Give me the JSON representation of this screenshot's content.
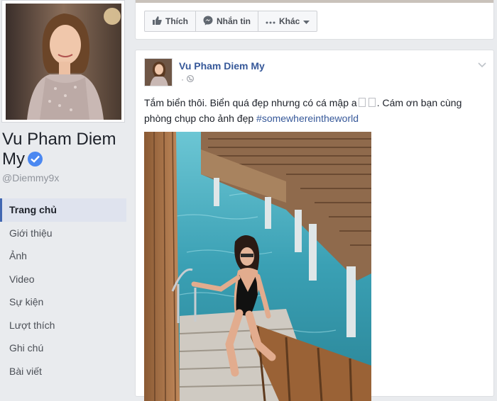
{
  "profile": {
    "name": "Vu Pham Diem My",
    "handle": "@Diemmy9x"
  },
  "nav": {
    "items": [
      {
        "label": "Trang chủ",
        "active": true
      },
      {
        "label": "Giới thiệu"
      },
      {
        "label": "Ảnh"
      },
      {
        "label": "Video"
      },
      {
        "label": "Sự kiện"
      },
      {
        "label": "Lượt thích"
      },
      {
        "label": "Ghi chú"
      },
      {
        "label": "Bài viết"
      }
    ]
  },
  "actions": {
    "like": "Thích",
    "message": "Nhắn tin",
    "more": "Khác"
  },
  "post": {
    "author": "Vu Pham Diem My",
    "time": "·",
    "text_part1": "Tắm biển thôi. Biển quá đẹp nhưng có cá mập a",
    "text_part2": ". Cám ơn bạn cùng phòng chụp cho ảnh đẹp ",
    "hashtag": "#somewhereintheworld"
  },
  "colors": {
    "link": "#365899",
    "verified": "#4b88f1",
    "nav_active_bar": "#4267b2"
  },
  "icons": [
    "verified-badge-icon",
    "thumbs-up-icon",
    "messenger-icon",
    "more-dots-icon",
    "caret-down-icon",
    "globe-icon",
    "chevron-down-icon"
  ]
}
